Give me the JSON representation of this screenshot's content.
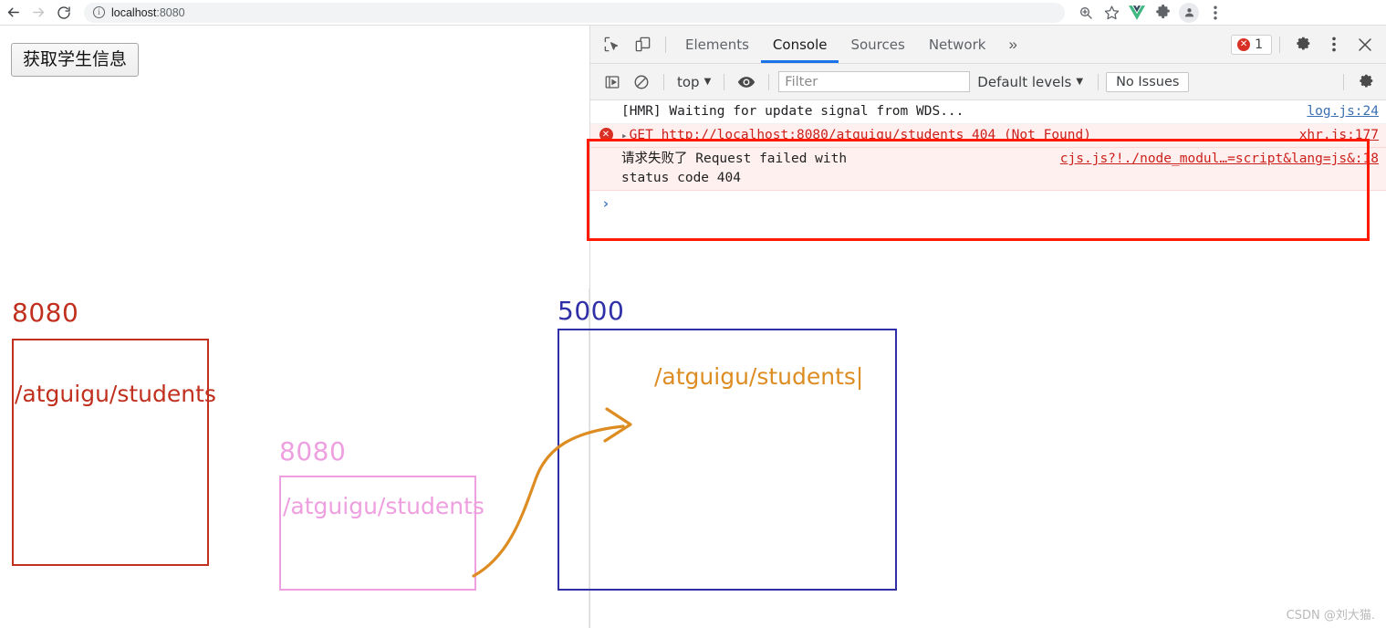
{
  "browser": {
    "back_icon": "back-arrow-icon",
    "forward_icon": "forward-arrow-icon",
    "reload_icon": "reload-icon",
    "omnibox": {
      "info_icon": "site-info-icon",
      "host": "localhost",
      "port": ":8080",
      "full_url": "localhost:8080"
    },
    "actions": [
      {
        "name": "zoom-icon",
        "glyph": "⊕"
      },
      {
        "name": "bookmark-star-icon",
        "glyph": "☆"
      },
      {
        "name": "vue-devtools-icon",
        "glyph": "V"
      },
      {
        "name": "extensions-puzzle-icon",
        "glyph": "❖"
      },
      {
        "name": "profile-avatar-icon",
        "glyph": "●"
      },
      {
        "name": "browser-menu-icon",
        "glyph": "⋮"
      }
    ]
  },
  "page": {
    "fetch_button_label": "获取学生信息"
  },
  "devtools": {
    "inspect_icon": "inspect-element-icon",
    "device_toolbar_icon": "device-toolbar-icon",
    "tabs": [
      {
        "label": "Elements",
        "active": false
      },
      {
        "label": "Console",
        "active": true
      },
      {
        "label": "Sources",
        "active": false
      },
      {
        "label": "Network",
        "active": false
      }
    ],
    "more_tabs_glyph": "»",
    "error_badge": {
      "count": "1",
      "icon": "error-circle-icon"
    },
    "settings_icon": "gear-icon",
    "dots_icon": "more-options-icon",
    "close_icon": "close-icon",
    "filterbar": {
      "sidebar_icon": "console-sidebar-icon",
      "clear_icon": "clear-console-icon",
      "context": "top",
      "context_caret": "▼",
      "eye_icon": "live-expression-icon",
      "filter_placeholder": "Filter",
      "filter_value": "",
      "levels": "Default levels",
      "levels_caret": "▼",
      "issues_button": "No Issues",
      "settings_icon": "console-settings-gear-icon"
    },
    "console_rows": [
      {
        "type": "info",
        "message": "[HMR] Waiting for update signal from WDS...",
        "source": "log.js:24"
      },
      {
        "type": "error",
        "disclosure": "▸",
        "method": "GET",
        "url": "http://localhost:8080/atguigu/students",
        "status": "404 (Not Found)",
        "source": "xhr.js:177"
      },
      {
        "type": "error2",
        "cn_prefix": "请求失败了",
        "message": "Request failed with\nstatus code 404",
        "source": "cjs.js?!./node_modul…=script&lang=js&:18"
      },
      {
        "type": "prompt",
        "caret": "›"
      }
    ]
  },
  "annotations": {
    "red": {
      "color": "#c1301f",
      "label": "8080",
      "text": "/atguigu/students"
    },
    "pink": {
      "color": "#ee9fe0",
      "label": "8080",
      "text": "/atguigu/students"
    },
    "blue": {
      "color": "#2f2fa8",
      "label": "5000"
    },
    "orange": {
      "color": "#dd8c22",
      "text": "/atguigu/students|"
    },
    "console_highlight_color": "#ff1a00"
  },
  "watermark": "CSDN @刘大猫."
}
